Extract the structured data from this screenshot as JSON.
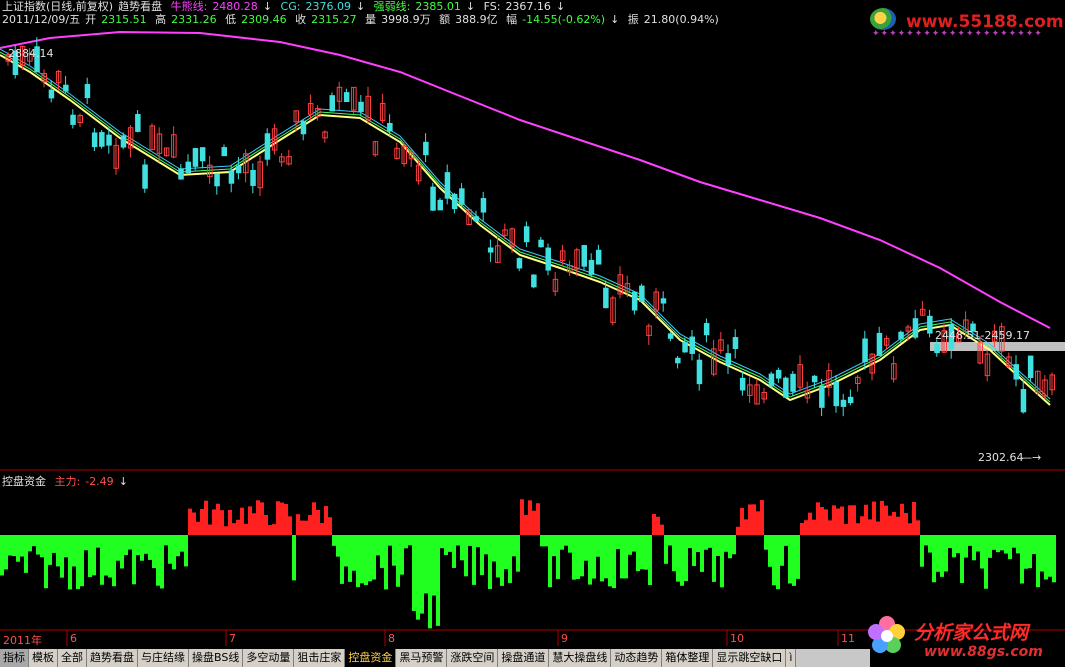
{
  "header": {
    "row1": {
      "title": "上证指数(日线,前复权)",
      "indicator_name": "趋势看盘",
      "niu_xiong_label": "牛熊线:",
      "niu_xiong_value": "2480.28",
      "cg_label": "CG:",
      "cg_value": "2376.09",
      "qiang_ruo_label": "强弱线:",
      "qiang_ruo_value": "2385.01",
      "fs_label": "FS:",
      "fs_value": "2367.16",
      "down_arrow": "↓"
    },
    "row2": {
      "date": "2011/12/09/五",
      "open_label": "开",
      "open": "2315.51",
      "high_label": "高",
      "high": "2331.26",
      "low_label": "低",
      "low": "2309.46",
      "close_label": "收",
      "close": "2315.27",
      "volume_label": "量",
      "volume": "3998.9万",
      "amount_label": "额",
      "amount": "388.9亿",
      "change_label": "幅",
      "change": "-14.55(-0.62%)",
      "down_arrow": "↓",
      "amplitude_label": "振",
      "amplitude": "21.80(0.94%)"
    }
  },
  "annotations": {
    "high_price": "2884.14",
    "range_label": "2448.51-2459.17",
    "low_price": "2302.64",
    "low_arrow": "—→"
  },
  "sub_chart": {
    "name": "控盘资金",
    "main_label": "主力:",
    "main_value": "-2.49",
    "down_arrow": "↓"
  },
  "time_axis": [
    "2011年",
    "6",
    "7",
    "8",
    "9",
    "10",
    "11"
  ],
  "tabs": [
    {
      "label": "指标",
      "state": "first"
    },
    {
      "label": "模板",
      "state": ""
    },
    {
      "label": "全部",
      "state": ""
    },
    {
      "label": "趋势看盘",
      "state": ""
    },
    {
      "label": "与庄结缘",
      "state": ""
    },
    {
      "label": "操盘BS线",
      "state": ""
    },
    {
      "label": "多空动量",
      "state": ""
    },
    {
      "label": "狙击庄家",
      "state": ""
    },
    {
      "label": "控盘资金",
      "state": "active"
    },
    {
      "label": "黑马预警",
      "state": ""
    },
    {
      "label": "涨跌空间",
      "state": ""
    },
    {
      "label": "操盘通道",
      "state": ""
    },
    {
      "label": "慧大操盘线",
      "state": ""
    },
    {
      "label": "动态趋势",
      "state": ""
    },
    {
      "label": "箱体整理",
      "state": ""
    },
    {
      "label": "显示跳空缺口",
      "state": ""
    },
    {
      "label": "ì",
      "state": ""
    }
  ],
  "logos": {
    "top_site": "www.55188.com",
    "top_stars": "✦✦✦✦✦✦✦✦✦✦✦✦✦✦✦✦✦✦✦✦",
    "bottom_title": "分析家公式网",
    "bottom_site": "www.88gs.com"
  },
  "colors": {
    "up": "#ff4040",
    "down": "#40e0e0",
    "ma_yellow": "#ffff80",
    "ma_magenta": "#ff40ff",
    "fund_positive": "#ff2020",
    "fund_negative": "#20ff20",
    "divider": "#b00000",
    "active_tab_text": "#ffd040"
  }
}
